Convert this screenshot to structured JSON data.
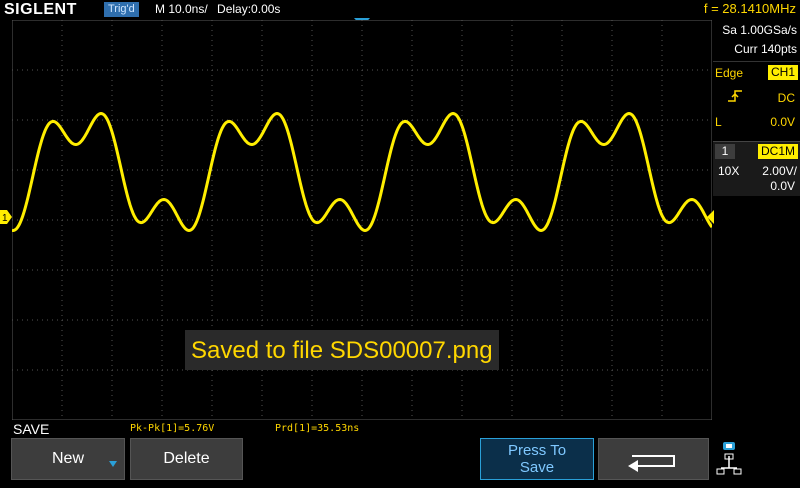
{
  "header": {
    "brand": "SIGLENT",
    "trigger_status": "Trig'd",
    "timebase": "M 10.0ns/",
    "delay": "Delay:0.00s",
    "frequency": "f = 28.1410MHz"
  },
  "acquisition": {
    "sample_rate": "Sa 1.00GSa/s",
    "memory": "Curr 140pts"
  },
  "trigger_panel": {
    "type": "Edge",
    "source": "CH1",
    "coupling": "DC",
    "level_label": "L",
    "level": "0.0V"
  },
  "channel_panel": {
    "channel": "1",
    "coupling": "DC1M",
    "probe": "10X",
    "scale": "2.00V/",
    "offset": "0.0V"
  },
  "waveform": {
    "channel_marker": "1",
    "color": "#ffee00"
  },
  "message": "Saved to file SDS00007.png",
  "menu": {
    "title": "SAVE",
    "measure_1": "Pk-Pk[1]=5.76V",
    "measure_2": "Prd[1]=35.53ns",
    "new_label": "New",
    "delete_label": "Delete",
    "press_to_save_line1": "Press To",
    "press_to_save_line2": "Save"
  },
  "colors": {
    "accent_blue": "#2aa0d8",
    "ch1_yellow": "#ffee00",
    "trigger_blue": "#2f6fae"
  }
}
